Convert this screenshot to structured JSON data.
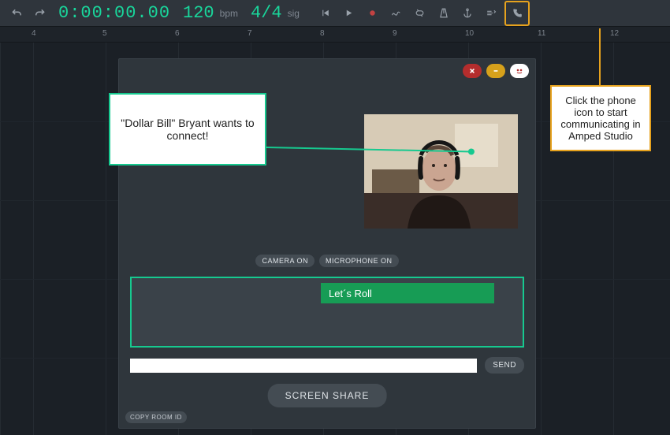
{
  "toolbar": {
    "time": "0:00:00.00",
    "tempo": "120",
    "tempo_unit": "bpm",
    "signature": "4/4",
    "signature_unit": "sig"
  },
  "ruler": {
    "ticks": [
      "4",
      "5",
      "6",
      "7",
      "8",
      "9",
      "10",
      "11",
      "12"
    ]
  },
  "panel": {
    "camera_label": "CAMERA ON",
    "mic_label": "MICROPHONE ON",
    "chat_message": "Let´s Roll",
    "send_label": "SEND",
    "screen_share_label": "SCREEN SHARE",
    "copy_room_label": "COPY ROOM ID",
    "msg_placeholder": ""
  },
  "callouts": {
    "connect_text": "\"Dollar Bill\" Bryant wants to connect!",
    "phone_hint": "Click the phone icon to start communicating in Amped Studio"
  },
  "colors": {
    "accent_green": "#16c98f",
    "accent_orange": "#e6a21e"
  }
}
